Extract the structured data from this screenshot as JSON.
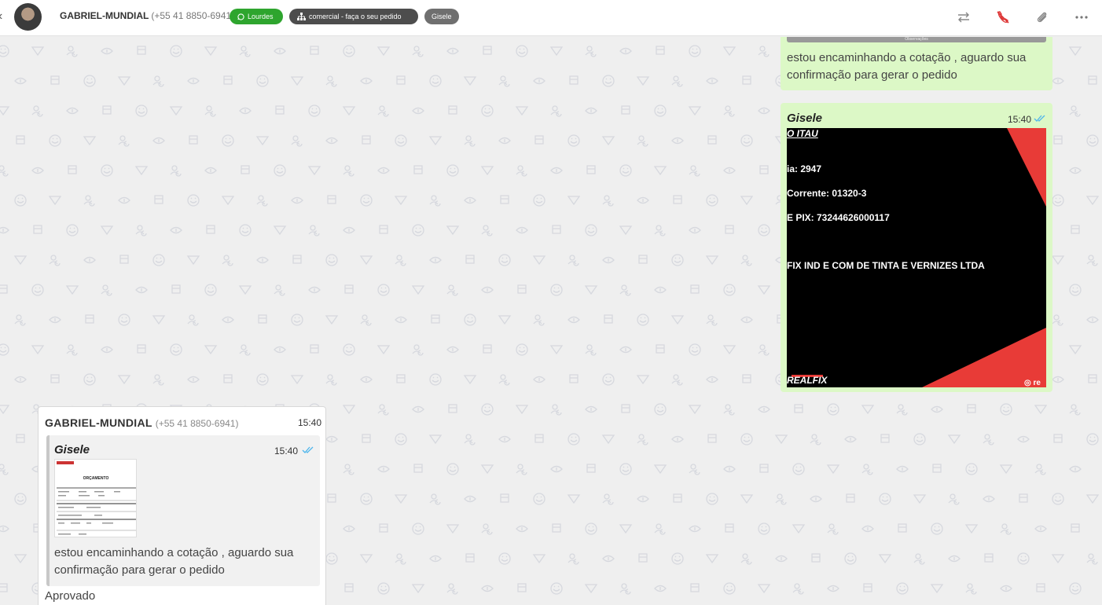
{
  "header": {
    "contact_name": "GABRIEL-MUNDIAL",
    "contact_phone": "(+55 41 8850-6941)",
    "tags": {
      "user": "Lourdes",
      "queue": "comercial - faça o seu pedido",
      "agent": "Gisele"
    },
    "colors": {
      "user_tag": "#2ea52e",
      "queue_tag": "#4d4d4d",
      "agent_tag": "#6f6f6f"
    }
  },
  "messages": {
    "out1": {
      "quoted_label": "Observações",
      "text": "estou encaminhando a cotação , aguardo sua confirmação para gerar o pedido"
    },
    "out2": {
      "sender": "Gisele",
      "time": "15:40",
      "image": {
        "bank": "O ITAU",
        "agencia": "ia: 2947",
        "conta": "Corrente: 01320-3",
        "chave": "E PIX: 73244626000117",
        "company": "FIX IND E COM DE TINTA E VERNIZES LTDA",
        "logo": "REALFIX",
        "insta": "re"
      }
    },
    "in1": {
      "contact_name": "GABRIEL-MUNDIAL",
      "contact_phone": "(+55 41 8850-6941)",
      "time": "15:40",
      "quote": {
        "sender": "Gisele",
        "time": "15:40",
        "thumb_title": "ORÇAMENTO",
        "text": "estou encaminhando a cotação , aguardo sua confirmação para gerar o pedido"
      },
      "caption": "Aprovado"
    }
  },
  "colors": {
    "outgoing_bubble": "#dcf8c6",
    "incoming_bubble": "#ffffff",
    "chat_bg": "#efefef",
    "read_check": "#4fb6ec"
  }
}
